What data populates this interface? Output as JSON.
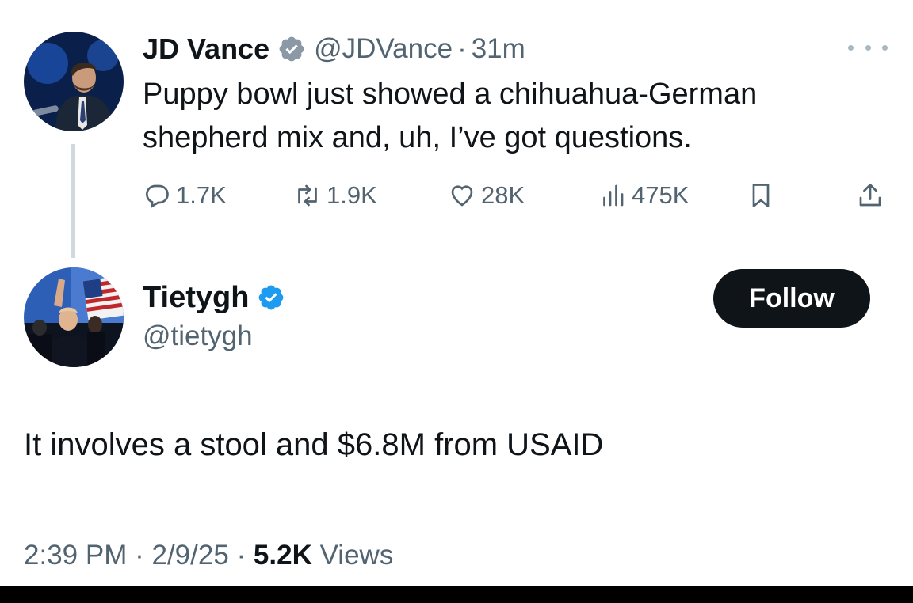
{
  "colors": {
    "verified_badge_main": "#8b98a5",
    "verified_badge_reply": "#1d9bf0",
    "follow_button_bg": "#0f1419",
    "muted_text": "#536471"
  },
  "original_tweet": {
    "author_name": "JD Vance",
    "handle": "@JDVance",
    "separator": "·",
    "time": "31m",
    "text_line1": "Puppy bowl just showed a chihuahua-German",
    "text_line2": "shepherd mix and, uh, I’ve got questions.",
    "more_icon": "more-horizontal-icon",
    "actions": {
      "replies": "1.7K",
      "retweets": "1.9K",
      "likes": "28K",
      "views": "475K"
    }
  },
  "reply_tweet": {
    "author_name": "Tietygh",
    "handle": "@tietygh",
    "follow_label": "Follow",
    "text": "It involves a stool and $6.8M from USAID",
    "timestamp": "2:39 PM",
    "date": "2/9/25",
    "separator": "·",
    "views_count": "5.2K",
    "views_label": "Views"
  }
}
